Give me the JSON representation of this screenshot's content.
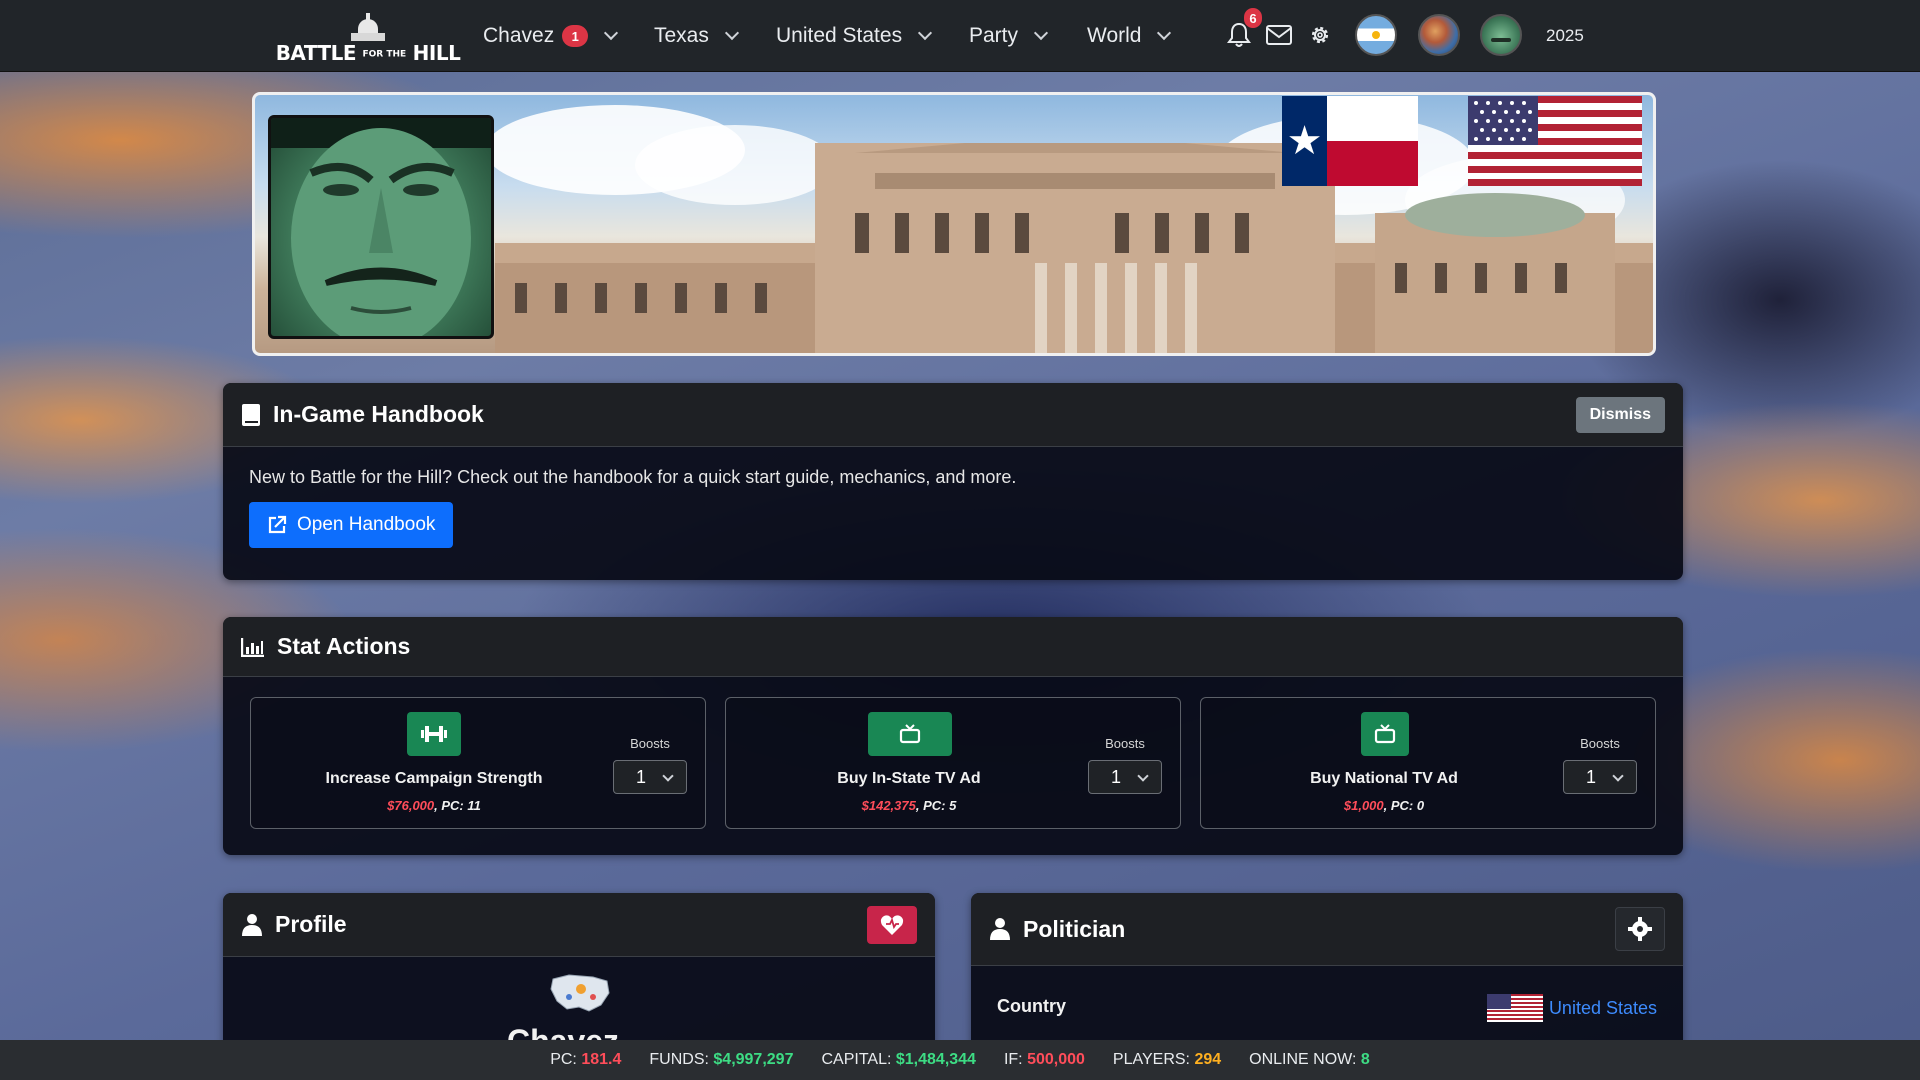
{
  "nav": {
    "brand_main": "BATTLE",
    "brand_small": "FOR THE",
    "brand_end": "HILL",
    "user": "Chavez",
    "user_badge": "1",
    "items": [
      "Texas",
      "United States",
      "Party",
      "World"
    ],
    "notification_count": "6",
    "year": "2025"
  },
  "handbook": {
    "title": "In-Game Handbook",
    "dismiss": "Dismiss",
    "text": "New to Battle for the Hill? Check out the handbook for a quick start guide, mechanics, and more.",
    "button": "Open Handbook"
  },
  "stats": {
    "title": "Stat Actions",
    "actions": [
      {
        "title": "Increase Campaign Strength",
        "cost": "$76,000",
        "pc": ", PC: 11",
        "boost_label": "Boosts",
        "boost_value": "1",
        "icon": "dumbbell-icon"
      },
      {
        "title": "Buy In-State TV Ad",
        "cost": "$142,375",
        "pc": ", PC: 5",
        "boost_label": "Boosts",
        "boost_value": "1",
        "icon": "tv-icon"
      },
      {
        "title": "Buy National TV Ad",
        "cost": "$1,000",
        "pc": ", PC: 0",
        "boost_label": "Boosts",
        "boost_value": "1",
        "icon": "tv-icon"
      }
    ]
  },
  "profile": {
    "title": "Profile",
    "name_partial": "Chavez"
  },
  "politician": {
    "title": "Politician",
    "country_label": "Country",
    "country_value": "United States"
  },
  "footer": {
    "pc_label": "PC:",
    "pc": "181.4",
    "funds_label": "FUNDS:",
    "funds": "$4,997,297",
    "capital_label": "CAPITAL:",
    "capital": "$1,484,344",
    "if_label": "IF:",
    "if": "500,000",
    "players_label": "PLAYERS:",
    "players": "294",
    "online_label": "ONLINE NOW:",
    "online": "8"
  },
  "colors": {
    "navbar": "#212529",
    "primary": "#0d6efd",
    "success": "#198754",
    "danger": "#dc3545",
    "heart_button": "#c8254a"
  }
}
